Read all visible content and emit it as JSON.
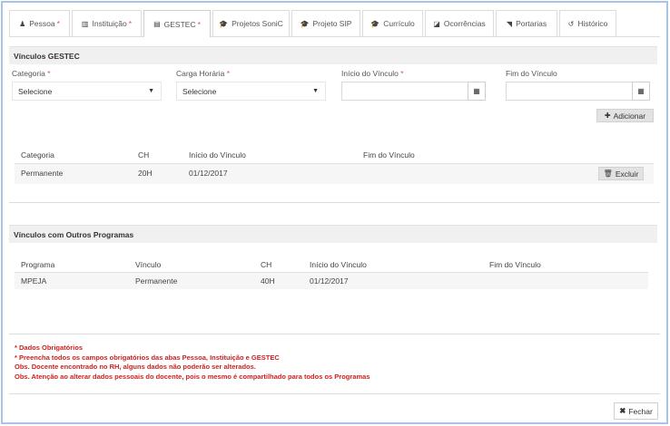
{
  "tabs": [
    {
      "label": "Pessoa",
      "icon": "♟",
      "required": "*"
    },
    {
      "label": "Instituição",
      "icon": "▥",
      "required": "*"
    },
    {
      "label": "GESTEC",
      "icon": "▤",
      "required": "*"
    },
    {
      "label": "Projetos SoniC",
      "icon": "🎓",
      "required": ""
    },
    {
      "label": "Projeto SIP",
      "icon": "🎓",
      "required": ""
    },
    {
      "label": "Currículo",
      "icon": "🎓",
      "required": ""
    },
    {
      "label": "Ocorrências",
      "icon": "◪",
      "required": ""
    },
    {
      "label": "Portarias",
      "icon": "◥",
      "required": ""
    },
    {
      "label": "Histórico",
      "icon": "↺",
      "required": ""
    }
  ],
  "gestec": {
    "title": "Vínculos GESTEC",
    "fields": {
      "categoria_label": "Categoria",
      "carga_label": "Carga Horária",
      "inicio_label": "Início do Vínculo",
      "fim_label": "Fim do Vínculo",
      "required_mark": "*",
      "categoria_value": "Selecione",
      "carga_value": "Selecione"
    },
    "add_label": "Adicionar",
    "table": {
      "headers": [
        "Categoria",
        "CH",
        "Início do Vínculo",
        "Fim do Vínculo"
      ],
      "rows": [
        {
          "categoria": "Permanente",
          "ch": "20H",
          "inicio": "01/12/2017",
          "fim": ""
        }
      ],
      "delete_label": "Excluir"
    }
  },
  "outros": {
    "title": "Vínculos com Outros Programas",
    "table": {
      "headers": [
        "Programa",
        "Vínculo",
        "CH",
        "Início do Vínculo",
        "Fim do Vínculo"
      ],
      "rows": [
        {
          "programa": "MPEJA",
          "vinculo": "Permanente",
          "ch": "40H",
          "inicio": "01/12/2017",
          "fim": ""
        }
      ]
    }
  },
  "notes": [
    "* Dados Obrigatórios",
    "* Preencha todos os campos obrigatórios das abas Pessoa, Instituição e GESTEC",
    "Obs. Docente encontrado no RH, alguns dados não poderão ser alterados.",
    "Obs. Atenção ao alterar dados pessoais do docente, pois o mesmo é compartilhado para todos os Programas"
  ],
  "close_label": "Fechar",
  "colors": {
    "required": "#d9534f",
    "note_text": "#cc1f1f",
    "frame_border": "#a8c4e6"
  }
}
